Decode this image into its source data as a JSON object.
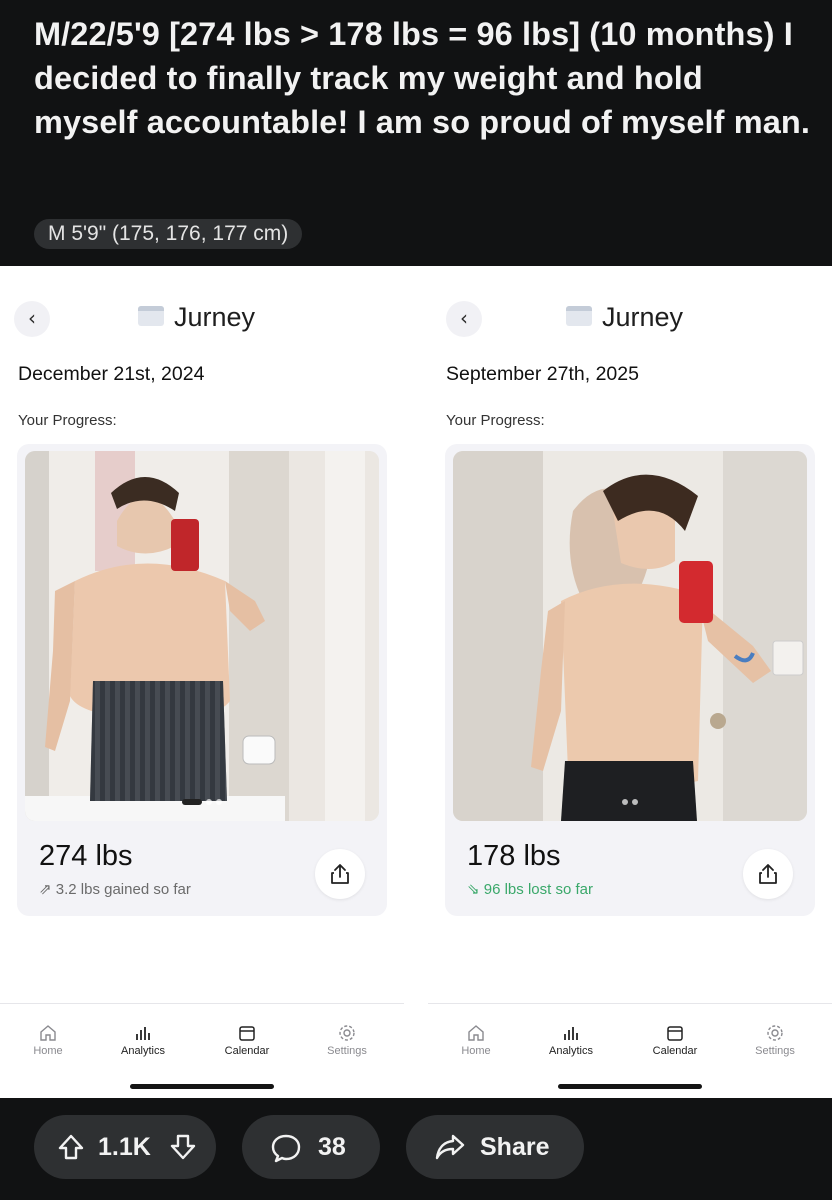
{
  "post": {
    "title": "M/22/5'9 [274 lbs > 178 lbs = 96 lbs] (10 months) I decided to finally track my weight and hold myself accountable! I am so proud of myself man.",
    "flair": "M 5'9\" (175, 176, 177 cm)"
  },
  "app_name": "Jurney",
  "progress_label": "Your Progress:",
  "left": {
    "date": "December 21st, 2024",
    "weight": "274 lbs",
    "change": "3.2 lbs gained so far",
    "change_icon": "trend-up-icon"
  },
  "right": {
    "date": "September 27th, 2025",
    "weight": "178 lbs",
    "change": "96 lbs lost so far",
    "change_icon": "trend-down-icon",
    "change_color": "#3aa86a"
  },
  "tabs": [
    {
      "label": "Home",
      "icon": "home-icon"
    },
    {
      "label": "Analytics",
      "icon": "analytics-icon"
    },
    {
      "label": "Calendar",
      "icon": "calendar-icon"
    },
    {
      "label": "Settings",
      "icon": "gear-icon"
    }
  ],
  "actions": {
    "votes": "1.1K",
    "comments": "38",
    "share": "Share"
  }
}
